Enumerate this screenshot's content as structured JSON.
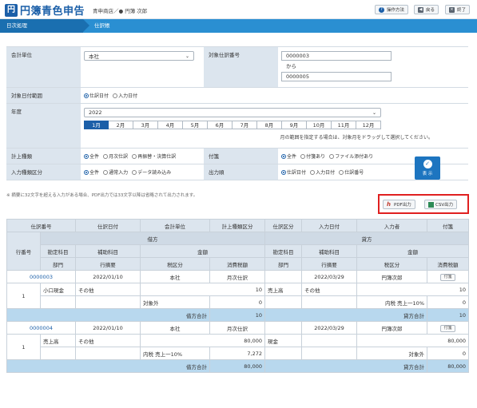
{
  "header": {
    "app_name": "円簿青色申告",
    "company": "青申商店／● 円簿 次郎",
    "help_label": "操作方法",
    "back_label": "戻る",
    "close_label": "終了"
  },
  "breadcrumb": {
    "level1": "日次処理",
    "level2": "仕訳帳"
  },
  "form": {
    "unit_label": "会計単位",
    "unit_value": "本社",
    "journal_no_label": "対象仕訳番号",
    "journal_no_from": "0000003",
    "journal_no_sep": "から",
    "journal_no_to": "0000005",
    "date_range_label": "対象日付範囲",
    "date_range_options": [
      "仕訳日付",
      "入力日付"
    ],
    "year_label": "年度",
    "year_value": "2022",
    "months": [
      "1月",
      "2月",
      "3月",
      "4月",
      "5月",
      "6月",
      "7月",
      "8月",
      "9月",
      "10月",
      "11月",
      "12月"
    ],
    "month_hint": "月の範囲を指定する場合は、対象月をドラッグして選択してください。",
    "posting_label": "計上種類",
    "posting_options": [
      "全件",
      "月次仕訳",
      "再振替・決算仕訳"
    ],
    "attach_label": "付箋",
    "attach_options": [
      "全件",
      "付箋あり",
      "ファイル添付あり"
    ],
    "input_type_label": "入力種類区分",
    "input_type_options": [
      "全件",
      "通常入力",
      "データ読み込み"
    ],
    "order_label": "出力順",
    "order_options": [
      "仕訳日付",
      "入力日付",
      "仕訳番号"
    ],
    "show_button": "表 示"
  },
  "note": "※ 摘要に32文字を超える入力がある場合、PDF出力では33文字以降は省略されて出力されます。",
  "exports": {
    "pdf_label": "PDF出力",
    "csv_label": "CSV出力"
  },
  "table": {
    "head1": [
      "仕訳番号",
      "仕訳日付",
      "会計単位",
      "計上種類区分",
      "仕訳区分",
      "入力日付",
      "入力者",
      "付箋"
    ],
    "debit": "借方",
    "credit": "貸方",
    "row_no": "行番号",
    "amount": "金額",
    "sub1": [
      "勘定科目",
      "補助科目"
    ],
    "sub2": [
      "部門",
      "行摘要",
      "税区分",
      "消費税額"
    ],
    "entries": [
      {
        "no": "0000003",
        "date": "2022/01/10",
        "unit": "本社",
        "posting": "月次仕訳",
        "input_date": "2022/03/29",
        "user": "円簿次郎",
        "tag": "付箋",
        "line": "1",
        "d_account": "小口現金",
        "d_sub": "その他",
        "d_amount": "10",
        "c_account": "売上高",
        "c_sub": "その他",
        "c_amount": "10",
        "d_tax": "対象外",
        "d_taxamt": "0",
        "c_tax": "内税 売上一10%",
        "c_taxamt": "0",
        "sum_label_d": "借方合計",
        "sum_d": "10",
        "sum_label_c": "貸方合計",
        "sum_c": "10"
      },
      {
        "no": "0000004",
        "date": "2022/01/10",
        "unit": "本社",
        "posting": "月次仕訳",
        "input_date": "2022/03/29",
        "user": "円簿次郎",
        "tag": "付箋",
        "line": "1",
        "d_account": "売上高",
        "d_sub": "その他",
        "d_amount": "80,000",
        "c_account": "現金",
        "c_sub": "",
        "c_amount": "80,000",
        "d_tax": "内税 売上一10%",
        "d_taxamt": "7,272",
        "c_tax": "対象外",
        "c_taxamt": "0",
        "sum_label_d": "借方合計",
        "sum_d": "80,000",
        "sum_label_c": "貸方合計",
        "sum_c": "80,000"
      }
    ]
  },
  "colors": {
    "brand": "#1b5fa8",
    "crumb": "#2a8fd2",
    "highlight": "#e02020"
  }
}
